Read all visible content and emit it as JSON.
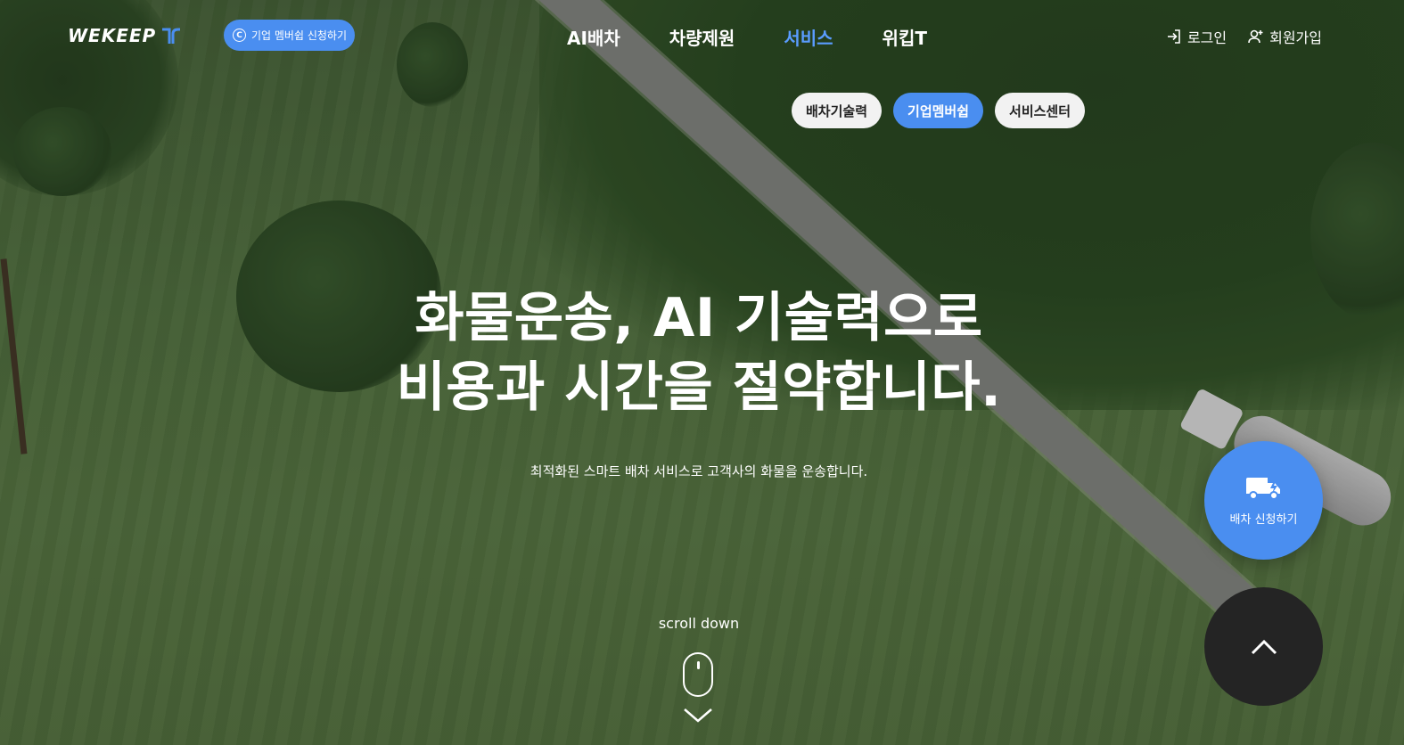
{
  "header": {
    "logo_text": "WEKEEP",
    "membership_button": "기업 멤버쉽 신청하기",
    "nav": [
      {
        "label": "AI배차",
        "active": false
      },
      {
        "label": "차량제원",
        "active": false
      },
      {
        "label": "서비스",
        "active": true
      },
      {
        "label": "위킵T",
        "active": false
      }
    ],
    "login": "로그인",
    "signup": "회원가입"
  },
  "subnav": [
    {
      "label": "배차기술력",
      "active": false
    },
    {
      "label": "기업멤버쉽",
      "active": true
    },
    {
      "label": "서비스센터",
      "active": false
    }
  ],
  "hero": {
    "line1": "화물운송, AI 기술력으로",
    "line2": "비용과 시간을 절약합니다.",
    "subtitle": "최적화된 스마트 배차 서비스로 고객사의 화물을 운송합니다."
  },
  "scroll_label": "scroll down",
  "fab": {
    "dispatch_label": "배차 신청하기"
  },
  "colors": {
    "accent": "#4a8ef0",
    "active_nav": "#5a9cff",
    "dark_fab": "#242424"
  },
  "icons": [
    "copyright-icon",
    "login-icon",
    "user-add-icon",
    "mouse-icon",
    "chevron-down-icon",
    "truck-bolt-icon",
    "arrow-up-icon"
  ]
}
